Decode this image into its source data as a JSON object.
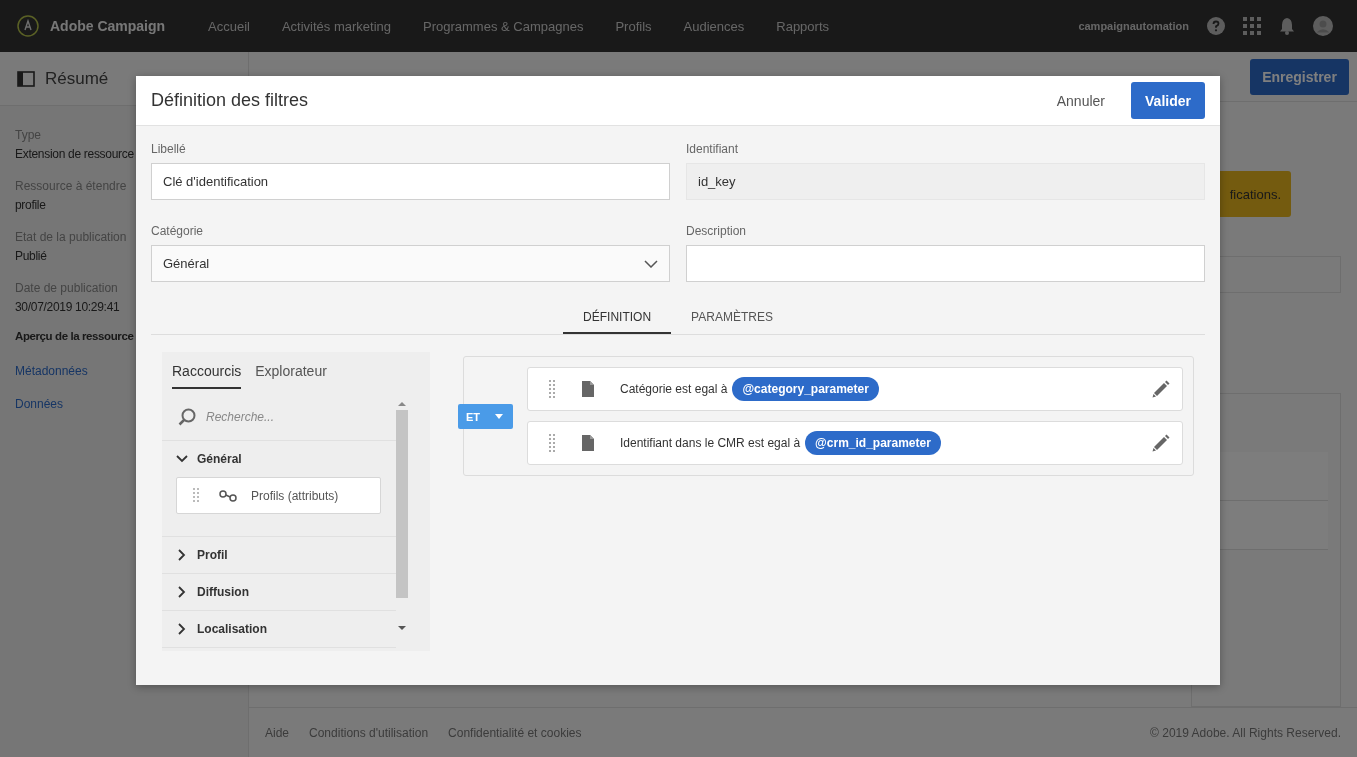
{
  "nav": {
    "brand": "Adobe Campaign",
    "items": [
      {
        "label": "Accueil"
      },
      {
        "label": "Activités marketing"
      },
      {
        "label": "Programmes & Campagnes"
      },
      {
        "label": "Profils"
      },
      {
        "label": "Audiences"
      },
      {
        "label": "Rapports"
      }
    ],
    "user": "campaignautomation"
  },
  "page_header": {
    "title": "Résumé",
    "save_button": "Enregistrer"
  },
  "sidebar": {
    "fields": [
      {
        "label": "Type",
        "value": "Extension de ressource"
      },
      {
        "label": "Ressource à étendre",
        "value": "profile"
      },
      {
        "label": "Etat de la publication",
        "value": "Publié"
      },
      {
        "label": "Date de publication",
        "value": "30/07/2019 10:29:41"
      }
    ],
    "section_title": "Aperçu de la ressource",
    "links": [
      {
        "label": "Métadonnées"
      },
      {
        "label": "Données"
      }
    ]
  },
  "banner": {
    "text": "fications."
  },
  "footer": {
    "links": [
      {
        "label": "Aide"
      },
      {
        "label": "Conditions d'utilisation"
      },
      {
        "label": "Confidentialité et cookies"
      }
    ],
    "copyright": "© 2019 Adobe. All Rights Reserved."
  },
  "modal": {
    "title": "Définition des filtres",
    "cancel": "Annuler",
    "confirm": "Valider",
    "fields": [
      {
        "kind": "text",
        "label": "Libellé",
        "value": "Clé d'identification"
      },
      {
        "kind": "readonly",
        "label": "Identifiant",
        "value": "id_key"
      },
      {
        "kind": "select",
        "label": "Catégorie",
        "value": "Général"
      },
      {
        "kind": "text",
        "label": "Description"
      }
    ],
    "tabs": [
      {
        "label": "DÉFINITION",
        "selected": true
      },
      {
        "label": "PARAMÈTRES",
        "selected": false
      }
    ],
    "palette": {
      "tabs": [
        {
          "label": "Raccourcis",
          "selected": true
        },
        {
          "label": "Explorateur",
          "selected": false
        }
      ],
      "search_placeholder": "Recherche...",
      "tree": [
        {
          "label": "Général",
          "expanded": true,
          "children": [
            {
              "label": "Profils (attributs)"
            }
          ]
        },
        {
          "label": "Profil",
          "expanded": false
        },
        {
          "label": "Diffusion",
          "expanded": false
        },
        {
          "label": "Localisation",
          "expanded": false
        }
      ]
    },
    "conditions": {
      "operator": "ET",
      "rules": [
        {
          "text": "Catégorie est egal à",
          "parameter": "@category_parameter"
        },
        {
          "text": "Identifiant dans le CMR est egal à",
          "parameter": "@crm_id_parameter"
        }
      ]
    }
  }
}
